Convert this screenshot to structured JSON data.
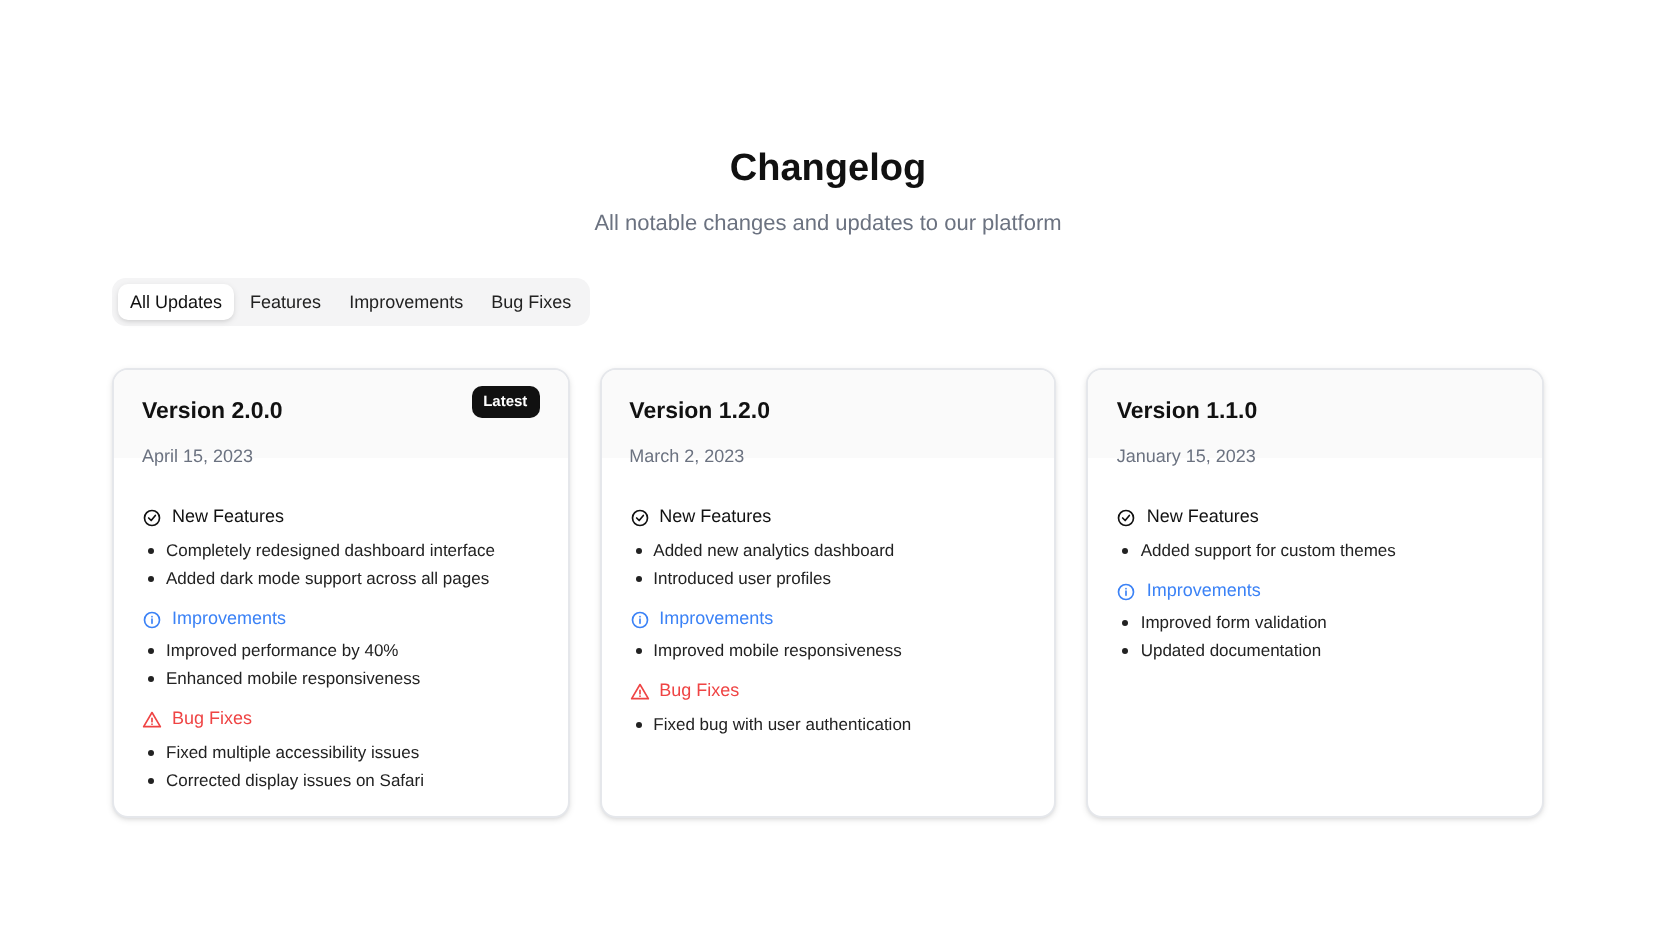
{
  "title": "Changelog",
  "subtitle": "All notable changes and updates to our platform",
  "tabs": [
    {
      "label": "All Updates",
      "selected": true
    },
    {
      "label": "Features",
      "selected": false
    },
    {
      "label": "Improvements",
      "selected": false
    },
    {
      "label": "Bug Fixes",
      "selected": false
    }
  ],
  "releases": [
    {
      "version": "Version 2.0.0",
      "date": "April 15, 2023",
      "badge": "Latest",
      "sections": [
        {
          "kind": "features",
          "title": "New Features",
          "items": [
            "Completely redesigned dashboard interface",
            "Added dark mode support across all pages"
          ]
        },
        {
          "kind": "improvements",
          "title": "Improvements",
          "items": [
            "Improved performance by 40%",
            "Enhanced mobile responsiveness"
          ]
        },
        {
          "kind": "bugfixes",
          "title": "Bug Fixes",
          "items": [
            "Fixed multiple accessibility issues",
            "Corrected display issues on Safari"
          ]
        }
      ]
    },
    {
      "version": "Version 1.2.0",
      "date": "March 2, 2023",
      "sections": [
        {
          "kind": "features",
          "title": "New Features",
          "items": [
            "Added new analytics dashboard",
            "Introduced user profiles"
          ]
        },
        {
          "kind": "improvements",
          "title": "Improvements",
          "items": [
            "Improved mobile responsiveness"
          ]
        },
        {
          "kind": "bugfixes",
          "title": "Bug Fixes",
          "items": [
            "Fixed bug with user authentication"
          ]
        }
      ]
    },
    {
      "version": "Version 1.1.0",
      "date": "January 15, 2023",
      "sections": [
        {
          "kind": "features",
          "title": "New Features",
          "items": [
            "Added support for custom themes"
          ]
        },
        {
          "kind": "improvements",
          "title": "Improvements",
          "items": [
            "Improved form validation",
            "Updated documentation"
          ]
        }
      ]
    }
  ]
}
